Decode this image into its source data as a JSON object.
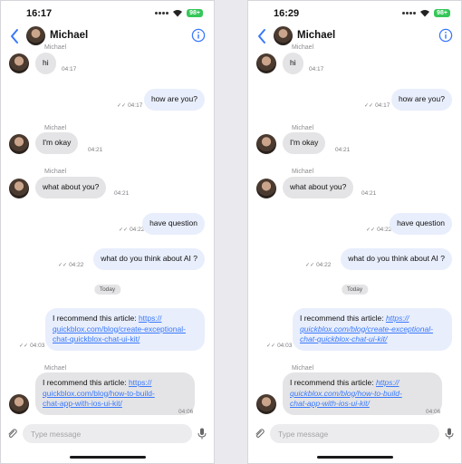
{
  "screens": [
    {
      "status_time": "16:17",
      "battery": "98+"
    },
    {
      "status_time": "16:29",
      "battery": "98+"
    }
  ],
  "header": {
    "contact_name": "Michael"
  },
  "sender_name": "Michael",
  "messages": [
    {
      "text": "hi",
      "time": "04:17"
    },
    {
      "text": "how are you?",
      "time": "04:17"
    },
    {
      "text": "I'm okay",
      "time": "04:21"
    },
    {
      "text": "what about you?",
      "time": "04:21"
    },
    {
      "text": "have question",
      "time": "04:22"
    },
    {
      "text": "what do you think about AI ?",
      "time": "04:22"
    },
    {
      "prefix": "I recommend this article: ",
      "link_lines": [
        "https://",
        "quickblox.com/blog/create-exceptional-",
        "chat-quickblox-chat-ui-kit/"
      ],
      "time": "04:03"
    },
    {
      "prefix": "I recommend this article: ",
      "link_lines": [
        "https://",
        "quickblox.com/blog/how-to-build-",
        "chat-app-with-ios-ui-kit/"
      ],
      "time": "04:06"
    }
  ],
  "date_separator": "Today",
  "input": {
    "placeholder": "Type message"
  },
  "colors": {
    "accent": "#3978fc",
    "incoming_bubble": "#e4e4e6",
    "outgoing_bubble": "#e8eefc",
    "battery": "#35c759"
  },
  "icons": [
    "back-chevron-icon",
    "info-icon",
    "wifi-icon",
    "attachment-icon",
    "microphone-icon",
    "double-check-icon"
  ]
}
